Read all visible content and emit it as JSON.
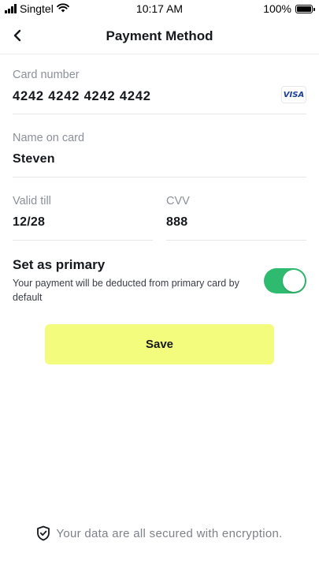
{
  "status_bar": {
    "carrier": "Singtel",
    "time": "10:17 AM",
    "battery": "100%"
  },
  "nav": {
    "back_icon": "chevron-left-icon",
    "title": "Payment Method"
  },
  "form": {
    "card_number": {
      "label": "Card number",
      "value": "4242 4242 4242 4242",
      "brand": "VISA"
    },
    "name": {
      "label": "Name on card",
      "value": "Steven"
    },
    "valid_till": {
      "label": "Valid till",
      "value": "12/28"
    },
    "cvv": {
      "label": "CVV",
      "value": "888"
    }
  },
  "primary": {
    "title": "Set as primary",
    "description": "Your payment will be deducted from primary card by default",
    "enabled": true
  },
  "actions": {
    "save_label": "Save"
  },
  "footer": {
    "icon": "shield-check-icon",
    "text": "Your data are all secured with encryption."
  },
  "colors": {
    "accent_button": "#f3fc7c",
    "toggle_on": "#2fbb6f",
    "visa_blue": "#1a3e9c"
  }
}
